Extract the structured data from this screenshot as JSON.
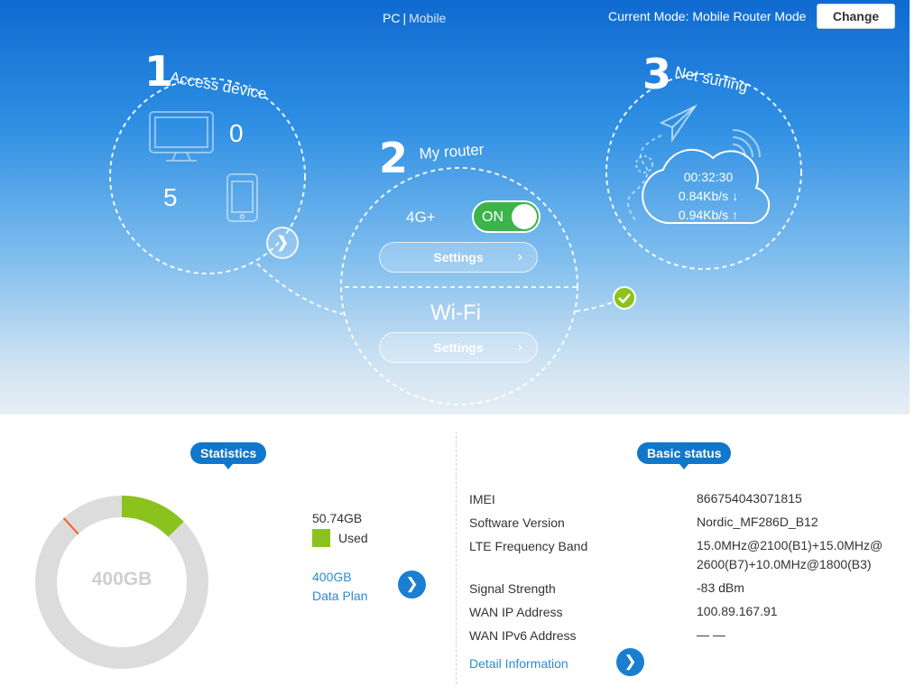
{
  "header": {
    "view_pc": "PC",
    "view_separator": "|",
    "view_mobile": "Mobile",
    "mode_text": "Current Mode: Mobile Router Mode",
    "change_label": "Change"
  },
  "steps": {
    "access": {
      "number": "1",
      "label": "Access device",
      "pc_count": "0",
      "mobile_count": "5",
      "arrow_icon": "chevron-right-icon"
    },
    "router": {
      "number": "2",
      "label": "My router",
      "network_type": "4G+",
      "toggle_label": "ON",
      "toggle_state": "on",
      "settings_label": "Settings",
      "wifi_label": "Wi-Fi",
      "wifi_settings_label": "Settings"
    },
    "surfing": {
      "number": "3",
      "label": "Net surfing",
      "duration": "00:32:30",
      "download": "0.84Kb/s ↓",
      "upload": "0.94Kb/s ↑",
      "status_icon": "check-circle-icon"
    }
  },
  "statistics": {
    "title": "Statistics",
    "total": "400GB",
    "used_value": "50.74GB",
    "used_label": "Used",
    "used_fraction": 0.12685,
    "plan_value": "400GB",
    "plan_label": "Data Plan",
    "colors": {
      "used": "#8cc21d",
      "remaining": "#dcdcdc",
      "marker": "#f26522"
    }
  },
  "basic_status": {
    "title": "Basic status",
    "rows": [
      {
        "label": "IMEI",
        "value": "866754043071815"
      },
      {
        "label": "Software Version",
        "value": "Nordic_MF286D_B12"
      },
      {
        "label": "LTE Frequency Band",
        "value": "15.0MHz@2100(B1)+15.0MHz@",
        "value2": "2600(B7)+10.0MHz@1800(B3)"
      },
      {
        "label": "Signal Strength",
        "value": "-83 dBm"
      },
      {
        "label": "WAN IP Address",
        "value": "100.89.167.91"
      },
      {
        "label": "WAN IPv6 Address",
        "value": "— —"
      }
    ],
    "detail_label": "Detail Information"
  }
}
